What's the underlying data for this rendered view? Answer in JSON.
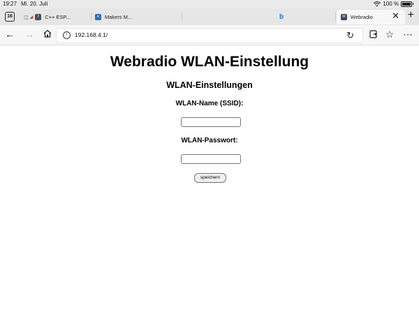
{
  "statusbar": {
    "time": "19:27",
    "date": "Mi. 20. Juli",
    "battery": "100 %"
  },
  "tabs": {
    "count": "16",
    "items": [
      {
        "label": "C++ ESP...",
        "icon": "generic-site-icon"
      },
      {
        "label": "Makers M...",
        "icon": "makers-icon"
      },
      {
        "label": "",
        "icon": "bing-icon"
      },
      {
        "label": "Webradio",
        "icon": "webradio-icon",
        "active": true
      }
    ]
  },
  "address_bar": {
    "url": "192.168.4.1/"
  },
  "page": {
    "title": "Webradio WLAN-Einstellung",
    "subtitle": "WLAN-Einstellungen",
    "ssid_label": "WLAN-Name (SSID):",
    "ssid_value": "",
    "password_label": "WLAN-Passwort:",
    "password_value": "",
    "save_label": "speichern"
  },
  "colors": {
    "chrome_bg": "#e6e6e6",
    "toolbar_bg": "#f7f7f7",
    "bing_blue": "#1a73e8"
  }
}
